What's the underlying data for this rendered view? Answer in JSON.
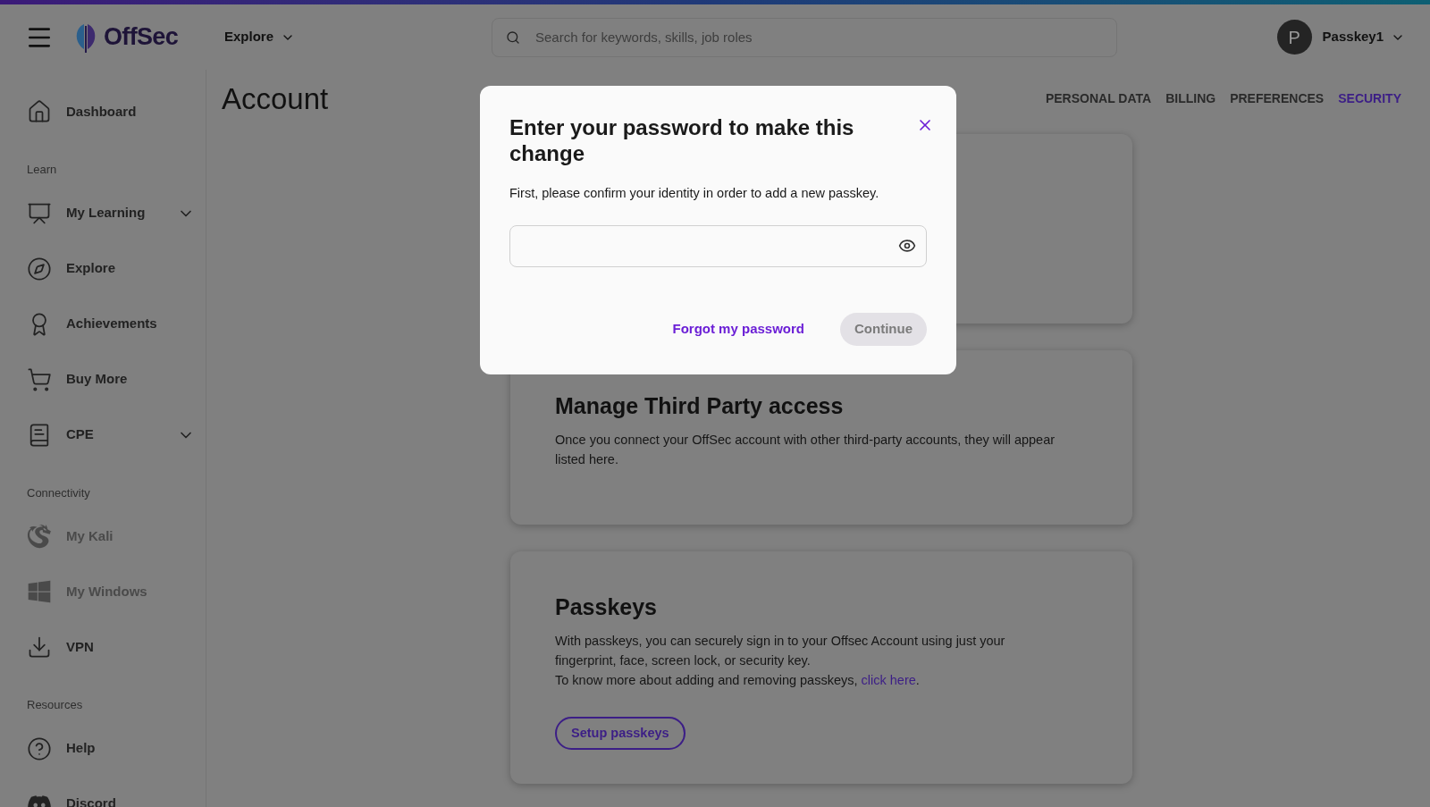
{
  "header": {
    "logo_text": "OffSec",
    "explore_menu": "Explore",
    "search": {
      "placeholder": "Search for keywords, skills, job roles"
    },
    "user": {
      "initial": "P",
      "name": "Passkey1"
    }
  },
  "sidebar": {
    "sections": [
      {
        "items": [
          {
            "label": "Dashboard",
            "expandable": false,
            "disabled": false
          }
        ]
      },
      {
        "label": "Learn",
        "items": [
          {
            "label": "My Learning",
            "expandable": true,
            "disabled": false
          },
          {
            "label": "Explore",
            "expandable": false,
            "disabled": false
          },
          {
            "label": "Achievements",
            "expandable": false,
            "disabled": false
          },
          {
            "label": "Buy More",
            "expandable": false,
            "disabled": false
          },
          {
            "label": "CPE",
            "expandable": true,
            "disabled": false
          }
        ]
      },
      {
        "label": "Connectivity",
        "items": [
          {
            "label": "My Kali",
            "expandable": false,
            "disabled": true
          },
          {
            "label": "My Windows",
            "expandable": false,
            "disabled": true
          },
          {
            "label": "VPN",
            "expandable": false,
            "disabled": false
          }
        ]
      },
      {
        "label": "Resources",
        "items": [
          {
            "label": "Help",
            "expandable": false,
            "disabled": false
          },
          {
            "label": "Discord",
            "expandable": false,
            "disabled": false
          }
        ]
      }
    ]
  },
  "page": {
    "title": "Account",
    "tabs": [
      {
        "label": "PERSONAL DATA",
        "selected": false
      },
      {
        "label": "BILLING",
        "selected": false
      },
      {
        "label": "PREFERENCES",
        "selected": false
      },
      {
        "label": "SECURITY",
        "selected": true
      }
    ],
    "cards": [
      {
        "kind": "info",
        "title": "Manage Third Party access",
        "text": "Once you connect your OffSec account with other third-party accounts, they will appear listed here."
      },
      {
        "kind": "passkeys",
        "title": "Passkeys",
        "text": "With passkeys, you can securely sign in to your Offsec Account using just your fingerprint, face, screen lock, or security key.",
        "link_prefix": "To know more about adding and removing passkeys,",
        "link": "click here",
        "link_suffix": ".",
        "button": "Setup passkeys"
      }
    ]
  },
  "dialog": {
    "title": "Enter your password to make this change",
    "text": "First, please confirm your identity in order to add a new passkey.",
    "link": "Forgot my password",
    "button": {
      "label": "Continue",
      "disabled": true
    }
  }
}
